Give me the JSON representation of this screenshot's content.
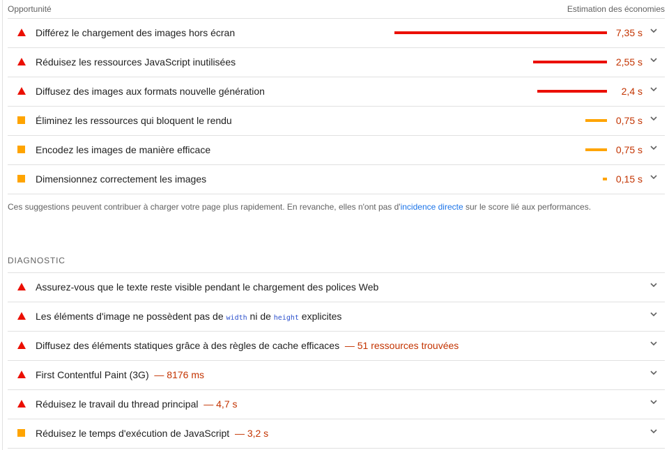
{
  "header": {
    "left_label": "Opportunité",
    "right_label": "Estimation des économies"
  },
  "opportunities": [
    {
      "icon": "fail-triangle-icon",
      "title": "Différez le chargement des images hors écran",
      "savings": "7,35 s",
      "bar_fraction": 1.0,
      "severity": "fail"
    },
    {
      "icon": "fail-triangle-icon",
      "title": "Réduisez les ressources JavaScript inutilisées",
      "savings": "2,55 s",
      "bar_fraction": 0.347,
      "severity": "fail"
    },
    {
      "icon": "fail-triangle-icon",
      "title": "Diffusez des images aux formats nouvelle génération",
      "savings": "2,4 s",
      "bar_fraction": 0.327,
      "severity": "fail"
    },
    {
      "icon": "average-square-icon",
      "title": "Éliminez les ressources qui bloquent le rendu",
      "savings": "0,75 s",
      "bar_fraction": 0.102,
      "severity": "average"
    },
    {
      "icon": "average-square-icon",
      "title": "Encodez les images de manière efficace",
      "savings": "0,75 s",
      "bar_fraction": 0.102,
      "severity": "average"
    },
    {
      "icon": "average-square-icon",
      "title": "Dimensionnez correctement les images",
      "savings": "0,15 s",
      "bar_fraction": 0.02,
      "severity": "average"
    }
  ],
  "footnote": {
    "text_before": "Ces suggestions peuvent contribuer à charger votre page plus rapidement. En revanche, elles n'ont pas d'",
    "link": "incidence directe",
    "text_after": " sur le score lié aux performances."
  },
  "diagnostic": {
    "title": "DIAGNOSTIC",
    "items": [
      {
        "title": "Assurez-vous que le texte reste visible pendant le chargement des polices Web",
        "severity": "fail"
      },
      {
        "title_before": "Les éléments d'image ne possèdent pas de ",
        "code1": "width",
        "title_middle": " ni de ",
        "code2": "height",
        "title_after": " explicites",
        "severity": "fail"
      },
      {
        "title": "Diffusez des éléments statiques grâce à des règles de cache efficaces",
        "display_value": "— 51 ressources trouvées",
        "severity": "fail"
      },
      {
        "title": "First Contentful Paint (3G)",
        "display_value": "— 8176 ms",
        "severity": "fail"
      },
      {
        "title": "Réduisez le travail du thread principal",
        "display_value": "— 4,7 s",
        "severity": "fail"
      },
      {
        "title": "Réduisez le temps d'exécution de JavaScript",
        "display_value": "— 3,2 s",
        "severity": "average"
      }
    ]
  },
  "colors": {
    "fail": "#eb0f00",
    "average": "#ffa400",
    "savings_text": "#c33300",
    "link": "#1a73e8"
  }
}
